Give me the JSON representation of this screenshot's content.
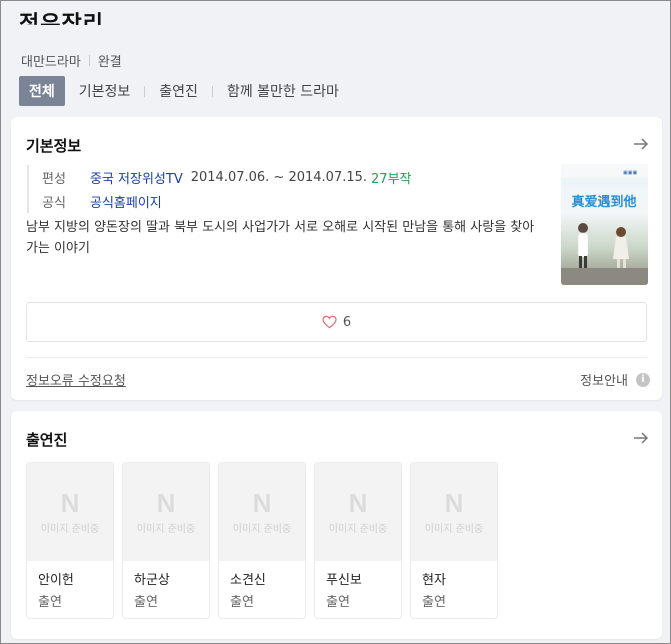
{
  "header": {
    "title": "정유작리",
    "meta": [
      "대만드라마",
      "완결"
    ],
    "tabs": [
      "전체",
      "기본정보",
      "출연진",
      "함께 볼만한 드라마"
    ]
  },
  "basic_info": {
    "title": "기본정보",
    "broadcast_label": "편성",
    "broadcaster": "중국 저장위성TV",
    "dates": "2014.07.06. ~ 2014.07.15.",
    "episodes": "27부작",
    "official_label": "공식",
    "official_link": "공식홈페이지",
    "description": "남부 지방의 양돈장의 딸과 북부 도시의 사업가가 서로 오해로 시작된 만남을 통해 사랑을 찾아가는 이야기",
    "poster_title": "真爱遇到他",
    "likes": "6",
    "report_link": "정보오류 수정요청",
    "guide": "정보안내"
  },
  "cast": {
    "title": "출연진",
    "placeholder_text": "이미지 준비중",
    "placeholder_logo": "N",
    "members": [
      {
        "name": "안이헌",
        "role": "출연"
      },
      {
        "name": "하군상",
        "role": "출연"
      },
      {
        "name": "소견신",
        "role": "출연"
      },
      {
        "name": "푸신보",
        "role": "출연"
      },
      {
        "name": "현자",
        "role": "출연"
      }
    ]
  },
  "colors": {
    "tab_active_bg": "#7b8496",
    "link_blue": "#1a3fa8",
    "episodes_green": "#1aa549",
    "heart": "#e06a7a"
  },
  "icons": [
    "arrow-right-icon",
    "heart-icon",
    "info-icon",
    "placeholder-n-icon"
  ]
}
